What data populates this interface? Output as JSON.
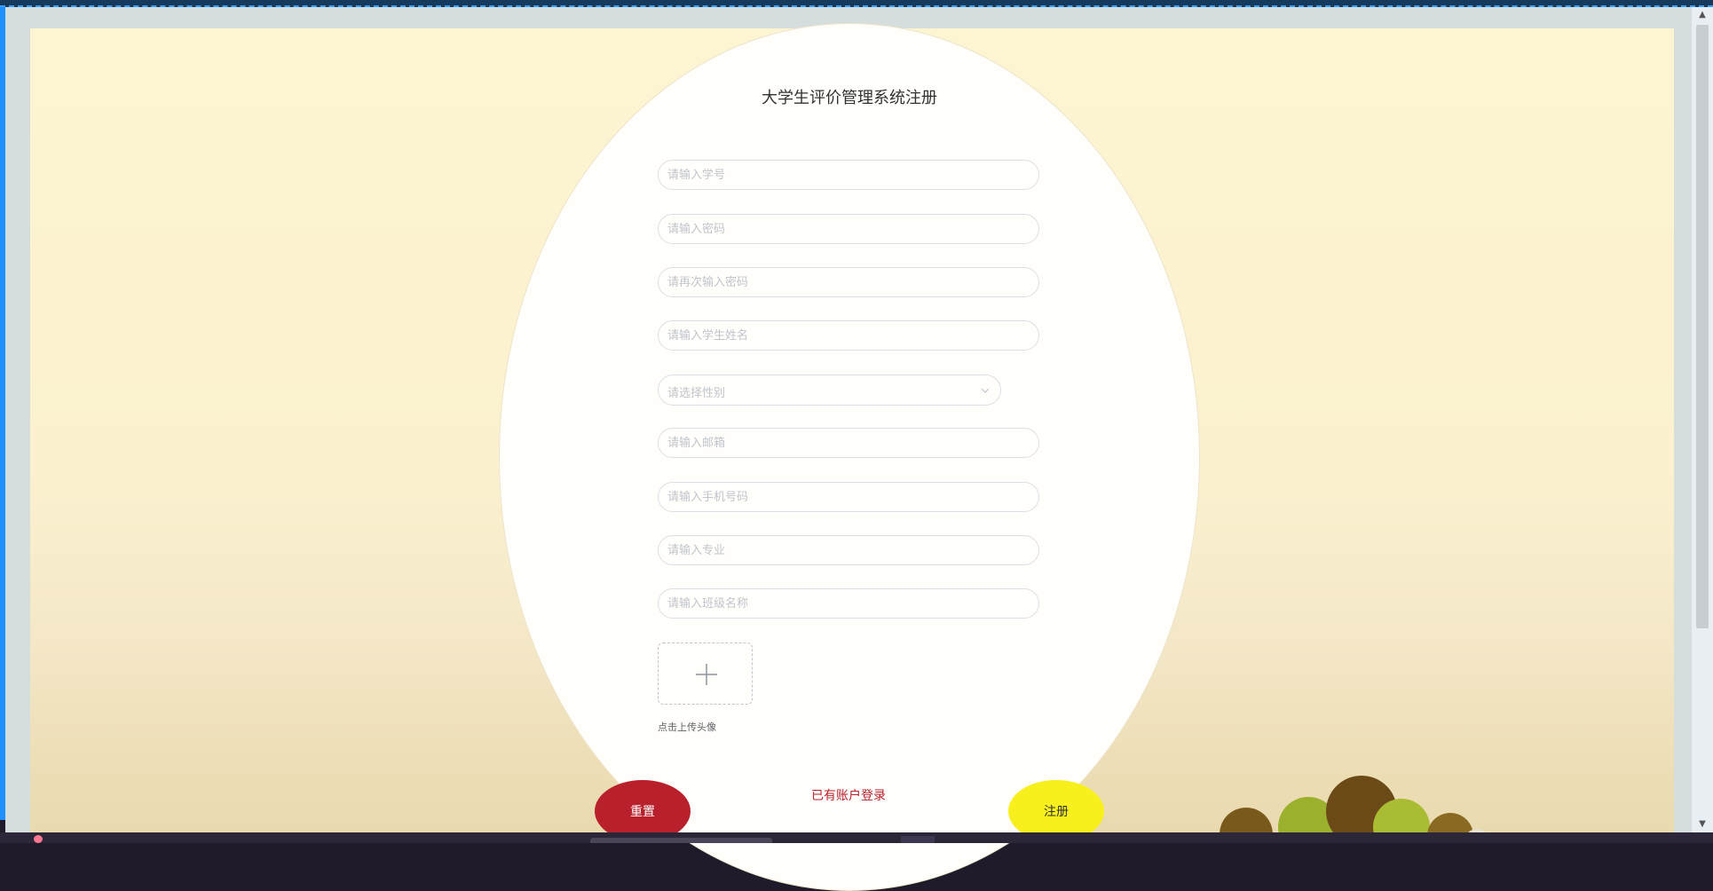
{
  "form": {
    "title": "大学生评价管理系统注册",
    "fields": [
      {
        "name": "student-id",
        "placeholder": "请输入学号"
      },
      {
        "name": "password",
        "placeholder": "请输入密码"
      },
      {
        "name": "confirm-password",
        "placeholder": "请再次输入密码"
      },
      {
        "name": "student-name",
        "placeholder": "请输入学生姓名"
      },
      {
        "name": "email",
        "placeholder": "请输入邮箱"
      },
      {
        "name": "phone",
        "placeholder": "请输入手机号码"
      },
      {
        "name": "major",
        "placeholder": "请输入专业"
      },
      {
        "name": "class-name",
        "placeholder": "请输入班级名称"
      }
    ],
    "gender_select": {
      "placeholder": "请选择性别",
      "icon": "chevron-down-icon"
    },
    "upload": {
      "icon": "plus-icon",
      "label": "点击上传头像"
    },
    "reset_label": "重置",
    "register_label": "注册",
    "login_link": "已有账户登录"
  },
  "colors": {
    "reset": "#b8202b",
    "register": "#f7f01c",
    "link": "#b8202b",
    "card": "#fffefa"
  }
}
